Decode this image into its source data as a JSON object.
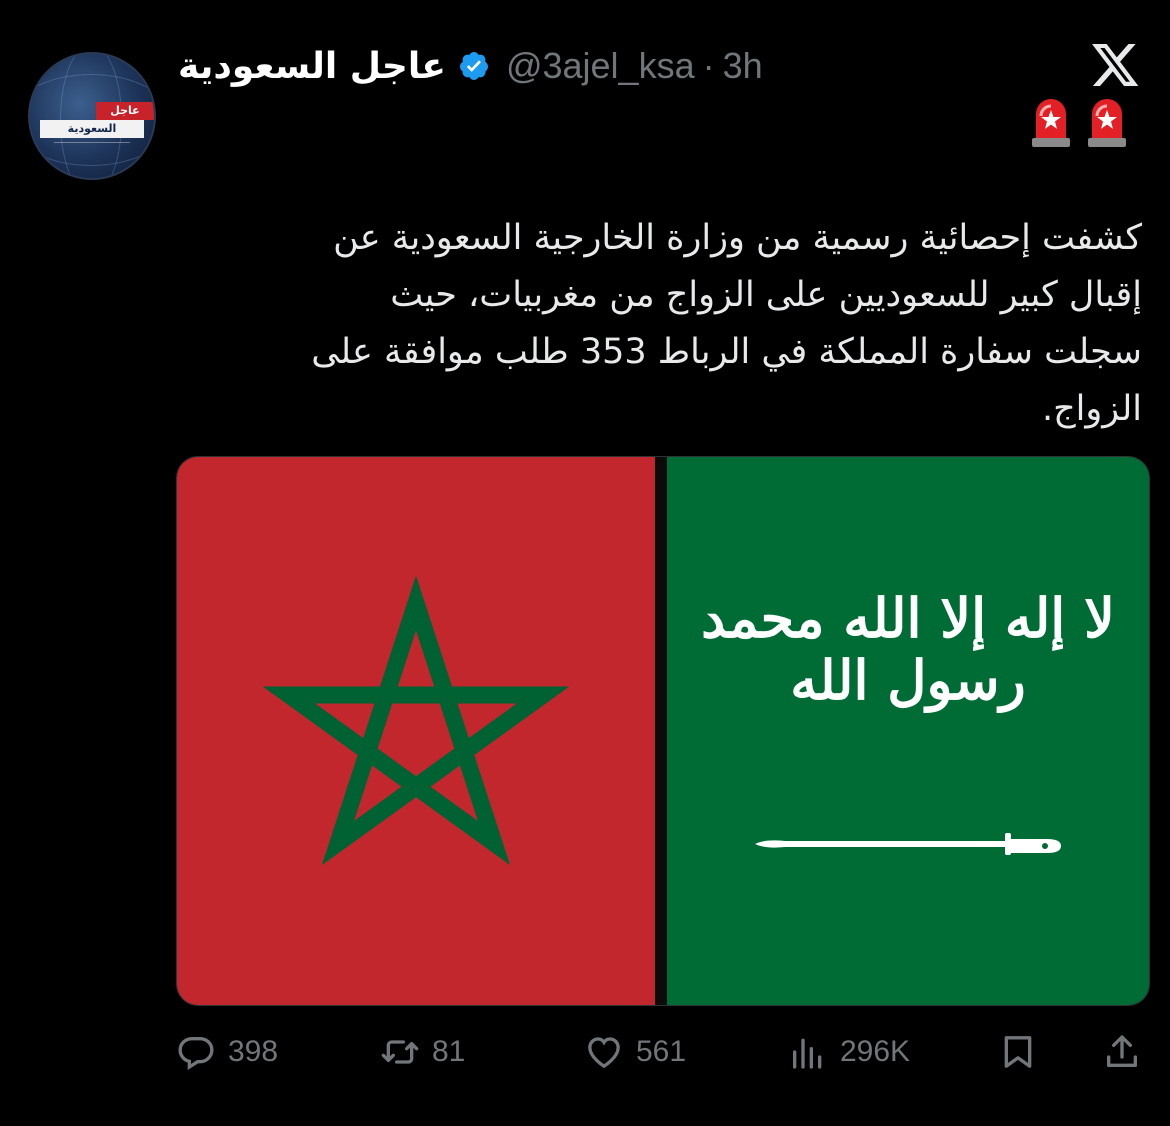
{
  "account": {
    "display_name": "عاجل السعودية",
    "handle": "@3ajel_ksa",
    "separator": "·",
    "time": "3h",
    "avatar_logo_top": "عاجل",
    "avatar_logo_bottom": "السعودية"
  },
  "tweet": {
    "lines": [
      "كشفت إحصائية رسمية من وزارة الخارجية السعودية عن",
      "إقبال كبير للسعوديين على الزواج من مغربيات، حيث",
      "سجلت سفارة المملكة في الرباط 353 طلب موافقة على",
      "الزواج."
    ]
  },
  "media": {
    "saudi_shahada": "لا إله إلا الله محمد رسول الله"
  },
  "actions": {
    "replies": "398",
    "reposts": "81",
    "likes": "561",
    "views": "296K"
  },
  "icons": {
    "platform": "x-logo-icon",
    "verified": "verified-badge-icon",
    "siren": "siren-icon",
    "reply": "reply-icon",
    "repost": "repost-icon",
    "like": "heart-icon",
    "views": "views-chart-icon",
    "bookmark": "bookmark-icon",
    "share": "share-icon"
  },
  "colors": {
    "background": "#000000",
    "text": "#e7e9ea",
    "muted": "#71767b",
    "verified": "#1d9bf0",
    "morocco_red": "#c1272d",
    "saudi_green": "#006c35",
    "star_green": "#006233"
  }
}
